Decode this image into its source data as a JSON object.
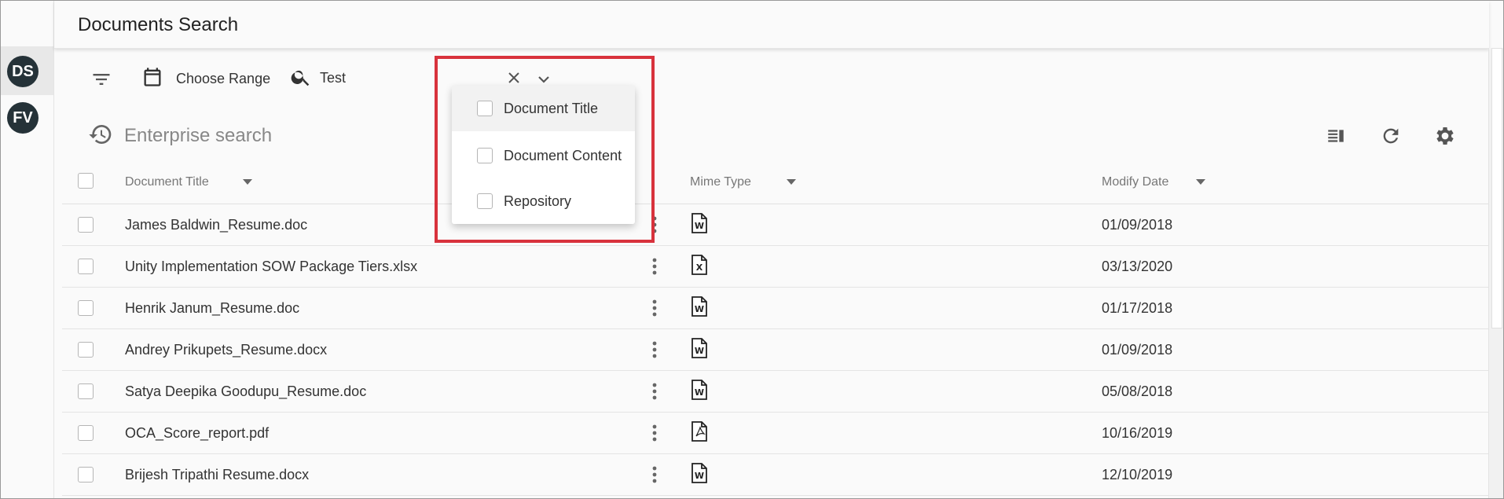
{
  "header": {
    "title": "Documents Search"
  },
  "rail": {
    "avatars": [
      "DS",
      "FV"
    ]
  },
  "toolbar": {
    "range_label": "Choose Range",
    "search_chip": "Test"
  },
  "search": {
    "placeholder": "Enterprise search"
  },
  "dropdown": {
    "options": [
      "Document Title",
      "Document Content",
      "Repository"
    ]
  },
  "table": {
    "columns": [
      "Document Title",
      "Mime Type",
      "Modify Date"
    ],
    "rows": [
      {
        "title": "James Baldwin_Resume.doc",
        "mime": "word",
        "date": "01/09/2018"
      },
      {
        "title": "Unity Implementation SOW Package Tiers.xlsx",
        "mime": "excel",
        "date": "03/13/2020"
      },
      {
        "title": "Henrik Janum_Resume.doc",
        "mime": "word",
        "date": "01/17/2018"
      },
      {
        "title": "Andrey Prikupets_Resume.docx",
        "mime": "word",
        "date": "01/09/2018"
      },
      {
        "title": "Satya Deepika Goodupu_Resume.doc",
        "mime": "word",
        "date": "05/08/2018"
      },
      {
        "title": "OCA_Score_report.pdf",
        "mime": "pdf",
        "date": "10/16/2019"
      },
      {
        "title": "Brijesh Tripathi Resume.docx",
        "mime": "word",
        "date": "12/10/2019"
      }
    ]
  },
  "colors": {
    "highlight": "#d8323c",
    "avatar_bg": "#253238"
  },
  "icons": [
    "filter-icon",
    "calendar-icon",
    "search-icon",
    "close-icon",
    "chevron-down-icon",
    "history-icon",
    "columns-icon",
    "refresh-icon",
    "gear-icon",
    "sort-down-icon",
    "kebab-icon",
    "word-file-icon",
    "excel-file-icon",
    "pdf-file-icon"
  ]
}
